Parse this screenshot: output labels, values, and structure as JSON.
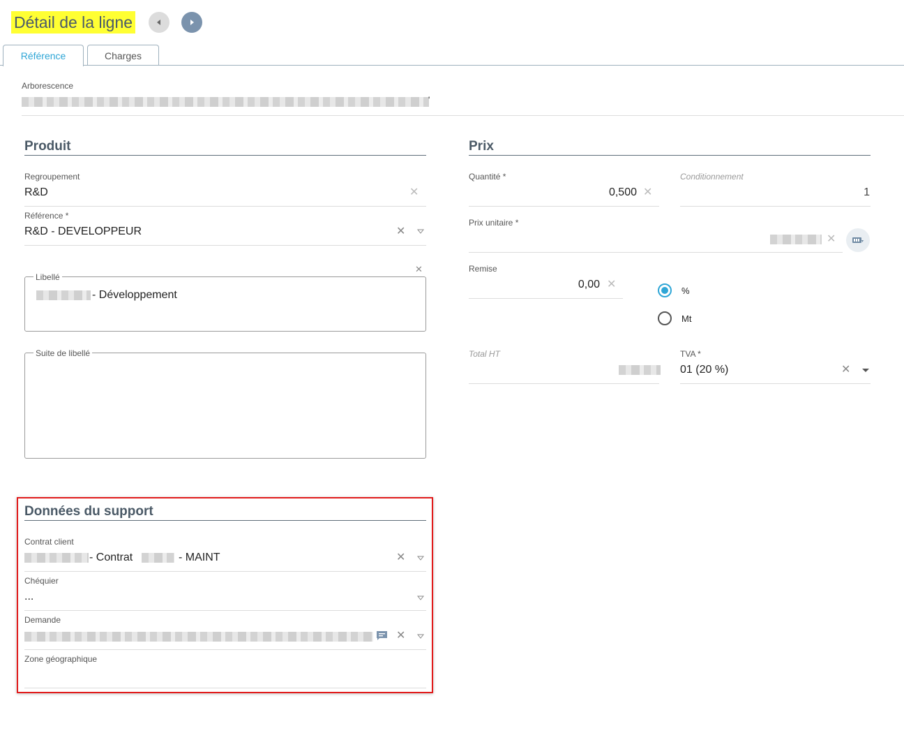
{
  "header": {
    "title": "Détail de la ligne"
  },
  "tabs": [
    {
      "label": "Référence"
    },
    {
      "label": "Charges"
    }
  ],
  "arborescence": {
    "label": "Arborescence",
    "value_suffix": "'"
  },
  "produit": {
    "title": "Produit",
    "regroupement": {
      "label": "Regroupement",
      "value": "R&D"
    },
    "reference": {
      "label": "Référence *",
      "value": "R&D - DEVELOPPEUR"
    },
    "libelle": {
      "label": "Libellé",
      "value_suffix": "- Développement"
    },
    "suite_libelle": {
      "label": "Suite de libellé",
      "value": ""
    }
  },
  "prix": {
    "title": "Prix",
    "quantite": {
      "label": "Quantité *",
      "value": "0,500"
    },
    "conditionnement": {
      "label": "Conditionnement",
      "value": "1"
    },
    "prix_unitaire": {
      "label": "Prix unitaire *"
    },
    "remise": {
      "label": "Remise",
      "value": "0,00"
    },
    "remise_modes": [
      {
        "label": "%",
        "selected": true
      },
      {
        "label": "Mt",
        "selected": false
      }
    ],
    "total_ht": {
      "label": "Total HT"
    },
    "tva": {
      "label": "TVA *",
      "value": "01 (20 %)"
    }
  },
  "support": {
    "title": "Données du support",
    "contrat_client": {
      "label": "Contrat client",
      "part1": "- Contrat",
      "part2": "- MAINT"
    },
    "chequier": {
      "label": "Chéquier",
      "value": "..."
    },
    "demande": {
      "label": "Demande"
    },
    "zone_geographique": {
      "label": "Zone géographique",
      "value": ""
    }
  },
  "colors": {
    "accent": "#2fa6d6",
    "highlight": "#ffff33",
    "frame": "#e11b1b"
  }
}
